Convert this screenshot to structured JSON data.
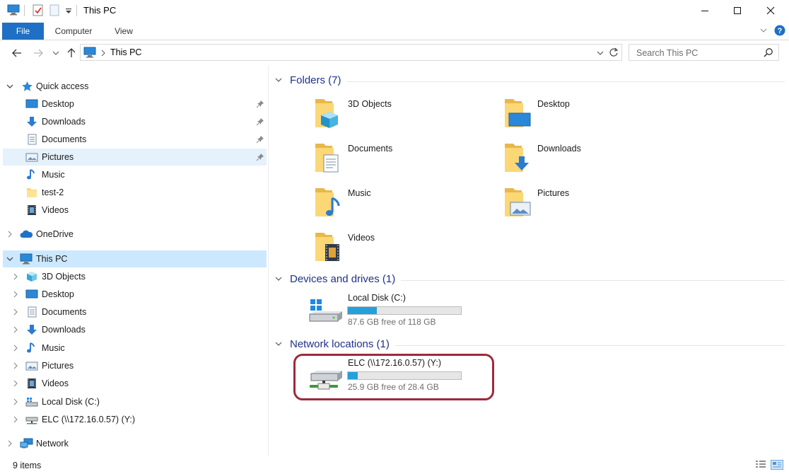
{
  "window": {
    "title": "This PC",
    "controls": [
      "minimize",
      "maximize",
      "close"
    ]
  },
  "ribbon": {
    "tabs": [
      {
        "label": "File",
        "active": true
      },
      {
        "label": "Computer"
      },
      {
        "label": "View"
      }
    ]
  },
  "address": {
    "path": "This PC",
    "search_placeholder": "Search This PC"
  },
  "sidebar": {
    "quick_access": {
      "label": "Quick access",
      "items": [
        {
          "label": "Desktop",
          "icon": "desktop-icon",
          "pinned": true
        },
        {
          "label": "Downloads",
          "icon": "downloads-icon",
          "pinned": true
        },
        {
          "label": "Documents",
          "icon": "documents-icon",
          "pinned": true
        },
        {
          "label": "Pictures",
          "icon": "pictures-icon",
          "pinned": true
        },
        {
          "label": "Music",
          "icon": "music-icon"
        },
        {
          "label": "test-2",
          "icon": "folder-icon"
        },
        {
          "label": "Videos",
          "icon": "videos-icon"
        }
      ]
    },
    "onedrive": {
      "label": "OneDrive"
    },
    "this_pc": {
      "label": "This PC",
      "items": [
        {
          "label": "3D Objects",
          "icon": "3d-objects-icon"
        },
        {
          "label": "Desktop",
          "icon": "desktop-icon"
        },
        {
          "label": "Documents",
          "icon": "documents-icon"
        },
        {
          "label": "Downloads",
          "icon": "downloads-icon"
        },
        {
          "label": "Music",
          "icon": "music-icon"
        },
        {
          "label": "Pictures",
          "icon": "pictures-icon"
        },
        {
          "label": "Videos",
          "icon": "videos-icon"
        },
        {
          "label": "Local Disk (C:)",
          "icon": "local-disk-icon"
        },
        {
          "label": "ELC (\\\\172.16.0.57) (Y:)",
          "icon": "network-drive-icon"
        }
      ]
    },
    "network": {
      "label": "Network"
    }
  },
  "content": {
    "folders": {
      "title": "Folders (7)",
      "items": [
        {
          "label": "3D Objects"
        },
        {
          "label": "Desktop"
        },
        {
          "label": "Documents"
        },
        {
          "label": "Downloads"
        },
        {
          "label": "Music"
        },
        {
          "label": "Pictures"
        },
        {
          "label": "Videos"
        }
      ]
    },
    "devices": {
      "title": "Devices and drives (1)",
      "items": [
        {
          "name": "Local Disk (C:)",
          "free_text": "87.6 GB free of 118 GB",
          "used_fraction": 0.258
        }
      ]
    },
    "network_locations": {
      "title": "Network locations (1)",
      "items": [
        {
          "name": "ELC (\\\\172.16.0.57) (Y:)",
          "free_text": "25.9 GB free of 28.4 GB",
          "used_fraction": 0.088
        }
      ]
    }
  },
  "status": {
    "count": "9 items"
  },
  "colors": {
    "accent": "#1f6fc5",
    "selection": "#cce8ff",
    "hover": "#e5f1fb",
    "group_title": "#1e3287",
    "drive_fill": "#26a0da",
    "highlight_ring": "#9c2a3c"
  }
}
